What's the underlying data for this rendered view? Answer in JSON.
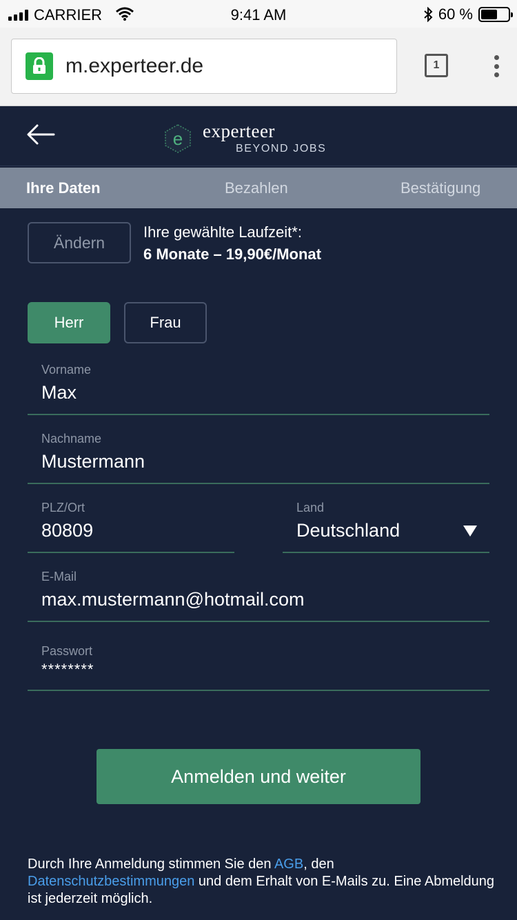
{
  "status_bar": {
    "carrier": "CARRIER",
    "time": "9:41 AM",
    "battery_percent": "60 %",
    "battery_level": 0.6
  },
  "browser": {
    "url": "m.experteer.de",
    "tab_count": "1"
  },
  "header": {
    "brand": "experteer",
    "tagline": "BEYOND JOBS",
    "colors": {
      "brand_green": "#3f8a69",
      "background": "#182239"
    }
  },
  "steps": {
    "items": [
      {
        "label": "Ihre Daten",
        "active": true
      },
      {
        "label": "Bezahlen",
        "active": false
      },
      {
        "label": "Bestätigung",
        "active": false
      }
    ]
  },
  "plan": {
    "change_label": "Ändern",
    "label": "Ihre gewählte Laufzeit*:",
    "value": "6 Monate – 19,90€/Monat"
  },
  "gender": {
    "options": [
      "Herr",
      "Frau"
    ],
    "selected": "Herr"
  },
  "form": {
    "first_name": {
      "label": "Vorname",
      "value": "Max"
    },
    "last_name": {
      "label": "Nachname",
      "value": "Mustermann"
    },
    "zip": {
      "label": "PLZ/Ort",
      "value": "80809"
    },
    "country": {
      "label": "Land",
      "value": "Deutschland"
    },
    "email": {
      "label": "E-Mail",
      "value": "max.mustermann@hotmail.com"
    },
    "password": {
      "label": "Passwort",
      "value": "********"
    }
  },
  "submit_label": "Anmelden und weiter",
  "legal": {
    "prefix": "Durch Ihre Anmeldung stimmen Sie den ",
    "agb": "AGB",
    "mid": ", den ",
    "privacy": "Datenschutzbestimmungen",
    "suffix": " und dem Erhalt von E-Mails zu. Eine Abmeldung ist jederzeit möglich.",
    "link_color": "#4a9eea"
  }
}
